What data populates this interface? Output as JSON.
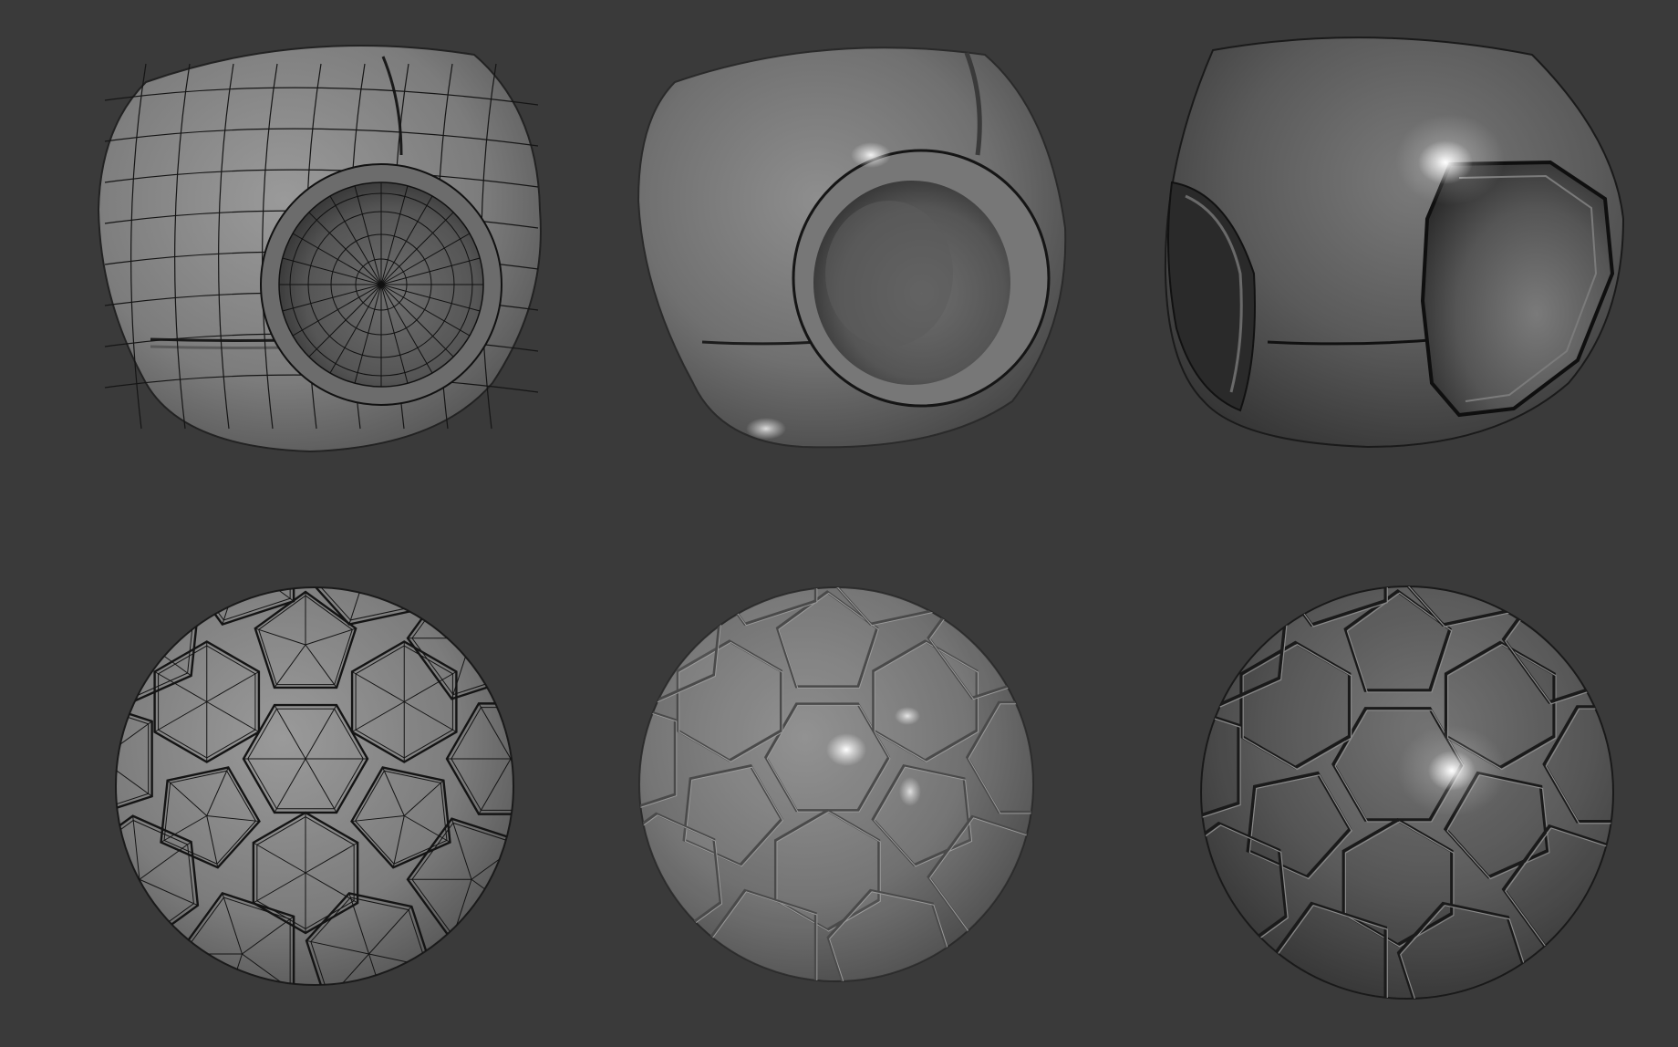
{
  "scene": {
    "background": "#3a3a3a",
    "surface_base": "#8a8a8a",
    "surface_dark": "#3f3f3f",
    "wire_color": "#141414",
    "specular_color": "#ffffff",
    "objects": [
      {
        "name": "cut-ball-wireframe",
        "shape": "truncated-sphere-with-opening",
        "shading": "wireframe-over-shaded"
      },
      {
        "name": "cut-ball-smooth",
        "shape": "truncated-sphere-with-opening",
        "shading": "smooth-matte"
      },
      {
        "name": "cut-ball-glossy",
        "shape": "truncated-sphere-with-two-openings",
        "shading": "smooth-glossy"
      },
      {
        "name": "soccer-ball-wireframe",
        "shape": "truncated-icosahedron",
        "shading": "wireframe-over-shaded"
      },
      {
        "name": "soccer-ball-smooth",
        "shape": "truncated-icosahedron",
        "shading": "smooth-matte"
      },
      {
        "name": "soccer-ball-glossy",
        "shape": "truncated-icosahedron",
        "shading": "smooth-glossy"
      }
    ]
  }
}
